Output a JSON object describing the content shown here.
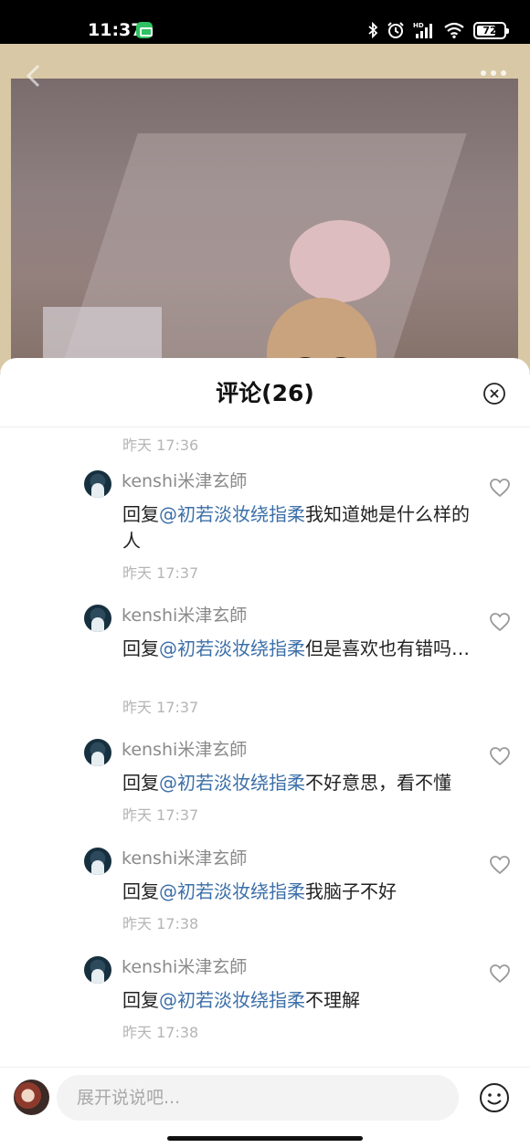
{
  "status_bar": {
    "time": "11:37",
    "battery": "72",
    "battery_level": 0.72,
    "icons": [
      "wechat-icon",
      "bluetooth-icon",
      "alarm-icon",
      "hd-signal-icon",
      "wifi-icon",
      "battery-icon"
    ]
  },
  "sheet": {
    "title": "评论(26)",
    "previous_time": "昨天 17:36"
  },
  "comments": [
    {
      "user": "kenshi米津玄師",
      "prefix": "回复",
      "mention": "@初若淡妆绕指柔",
      "text": "我知道她是什么样的人",
      "time": "昨天 17:37"
    },
    {
      "user": "kenshi米津玄師",
      "prefix": "回复",
      "mention": "@初若淡妆绕指柔",
      "text": "但是喜欢也有错吗…",
      "time": "昨天 17:37"
    },
    {
      "user": "kenshi米津玄師",
      "prefix": "回复",
      "mention": "@初若淡妆绕指柔",
      "text": "不好意思，看不懂",
      "time": "昨天 17:37"
    },
    {
      "user": "kenshi米津玄師",
      "prefix": "回复",
      "mention": "@初若淡妆绕指柔",
      "text": "我脑子不好",
      "time": "昨天 17:38"
    },
    {
      "user": "kenshi米津玄師",
      "prefix": "回复",
      "mention": "@初若淡妆绕指柔",
      "text": "不理解",
      "time": "昨天 17:38"
    }
  ],
  "input_bar": {
    "placeholder": "展开说说吧..."
  },
  "colors": {
    "mention": "#3c6fa8",
    "timestamp": "#b5b5b5",
    "username": "#8a8a8a"
  }
}
